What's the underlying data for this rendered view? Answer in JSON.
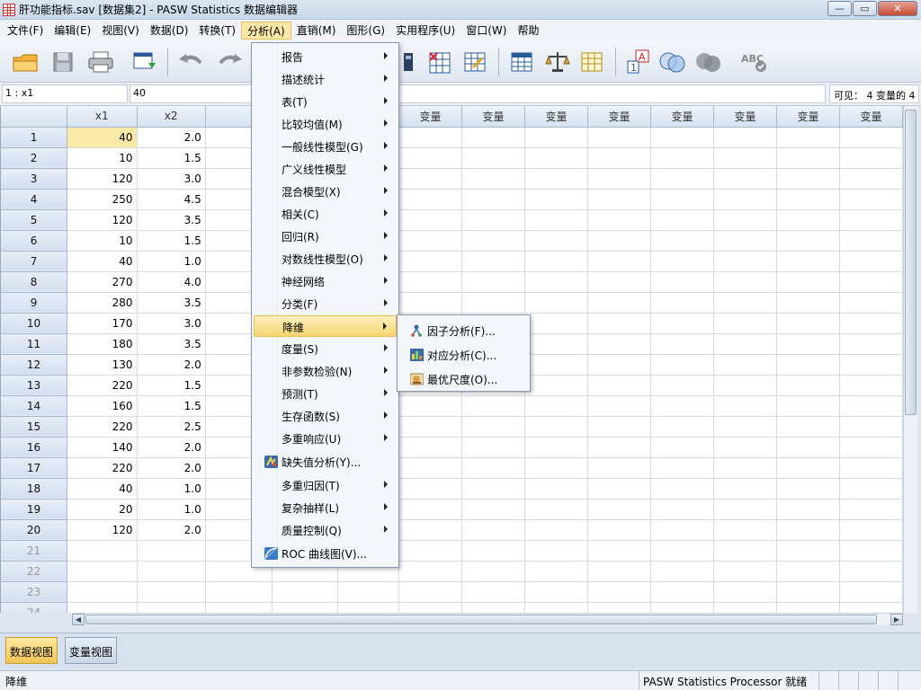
{
  "window": {
    "title": "肝功能指标.sav [数据集2] - PASW Statistics 数据编辑器",
    "min_label": "—",
    "max_label": "▭",
    "close_label": "✕"
  },
  "menubar": {
    "items": [
      "文件(F)",
      "编辑(E)",
      "视图(V)",
      "数据(D)",
      "转换(T)",
      "分析(A)",
      "直销(M)",
      "图形(G)",
      "实用程序(U)",
      "窗口(W)",
      "帮助"
    ]
  },
  "editor": {
    "cell_ref": "1 : x1",
    "cell_value": "40",
    "visible_info": "可见： 4 变量的 4"
  },
  "grid": {
    "columns": [
      "x1",
      "x2",
      "",
      "",
      "",
      "变量",
      "变量",
      "变量",
      "变量",
      "变量",
      "变量",
      "变量",
      "变量"
    ],
    "rows": [
      {
        "n": "1",
        "x1": "40",
        "x2": "2.0"
      },
      {
        "n": "2",
        "x1": "10",
        "x2": "1.5"
      },
      {
        "n": "3",
        "x1": "120",
        "x2": "3.0"
      },
      {
        "n": "4",
        "x1": "250",
        "x2": "4.5"
      },
      {
        "n": "5",
        "x1": "120",
        "x2": "3.5"
      },
      {
        "n": "6",
        "x1": "10",
        "x2": "1.5"
      },
      {
        "n": "7",
        "x1": "40",
        "x2": "1.0"
      },
      {
        "n": "8",
        "x1": "270",
        "x2": "4.0"
      },
      {
        "n": "9",
        "x1": "280",
        "x2": "3.5"
      },
      {
        "n": "10",
        "x1": "170",
        "x2": "3.0"
      },
      {
        "n": "11",
        "x1": "180",
        "x2": "3.5"
      },
      {
        "n": "12",
        "x1": "130",
        "x2": "2.0"
      },
      {
        "n": "13",
        "x1": "220",
        "x2": "1.5"
      },
      {
        "n": "14",
        "x1": "160",
        "x2": "1.5"
      },
      {
        "n": "15",
        "x1": "220",
        "x2": "2.5"
      },
      {
        "n": "16",
        "x1": "140",
        "x2": "2.0"
      },
      {
        "n": "17",
        "x1": "220",
        "x2": "2.0"
      },
      {
        "n": "18",
        "x1": "40",
        "x2": "1.0"
      },
      {
        "n": "19",
        "x1": "20",
        "x2": "1.0"
      },
      {
        "n": "20",
        "x1": "120",
        "x2": "2.0"
      },
      {
        "n": "21",
        "x1": "",
        "x2": ""
      },
      {
        "n": "22",
        "x1": "",
        "x2": ""
      },
      {
        "n": "23",
        "x1": "",
        "x2": ""
      },
      {
        "n": "24",
        "x1": "",
        "x2": ""
      }
    ]
  },
  "analyze_menu": {
    "items": [
      {
        "label": "报告",
        "submenu": true
      },
      {
        "label": "描述统计",
        "submenu": true
      },
      {
        "label": "表(T)",
        "submenu": true
      },
      {
        "label": "比较均值(M)",
        "submenu": true
      },
      {
        "label": "一般线性模型(G)",
        "submenu": true
      },
      {
        "label": "广义线性模型",
        "submenu": true
      },
      {
        "label": "混合模型(X)",
        "submenu": true
      },
      {
        "label": "相关(C)",
        "submenu": true
      },
      {
        "label": "回归(R)",
        "submenu": true
      },
      {
        "label": "对数线性模型(O)",
        "submenu": true
      },
      {
        "label": "神经网络",
        "submenu": true
      },
      {
        "label": "分类(F)",
        "submenu": true
      },
      {
        "label": "降维",
        "submenu": true,
        "highlighted": true
      },
      {
        "label": "度量(S)",
        "submenu": true
      },
      {
        "label": "非参数检验(N)",
        "submenu": true
      },
      {
        "label": "预测(T)",
        "submenu": true
      },
      {
        "label": "生存函数(S)",
        "submenu": true
      },
      {
        "label": "多重响应(U)",
        "submenu": true
      },
      {
        "label": "缺失值分析(Y)...",
        "submenu": false,
        "icon": "missing-value-icon"
      },
      {
        "label": "多重归因(T)",
        "submenu": true
      },
      {
        "label": "复杂抽样(L)",
        "submenu": true
      },
      {
        "label": "质量控制(Q)",
        "submenu": true
      },
      {
        "label": "ROC 曲线图(V)...",
        "submenu": false,
        "icon": "roc-curve-icon"
      }
    ]
  },
  "dimension_submenu": {
    "items": [
      {
        "label": "因子分析(F)...",
        "icon": "factor-analysis-icon"
      },
      {
        "label": "对应分析(C)...",
        "icon": "correspondence-analysis-icon"
      },
      {
        "label": "最优尺度(O)...",
        "icon": "optimal-scaling-icon"
      }
    ]
  },
  "tabs": {
    "data_view": "数据视图",
    "variable_view": "变量视图"
  },
  "status": {
    "left": "降维",
    "processor": "PASW Statistics Processor 就绪"
  },
  "colors": {
    "accent": "#f8d670",
    "selected_cell": "#fbe9a8",
    "header": "#d6e2f0"
  }
}
